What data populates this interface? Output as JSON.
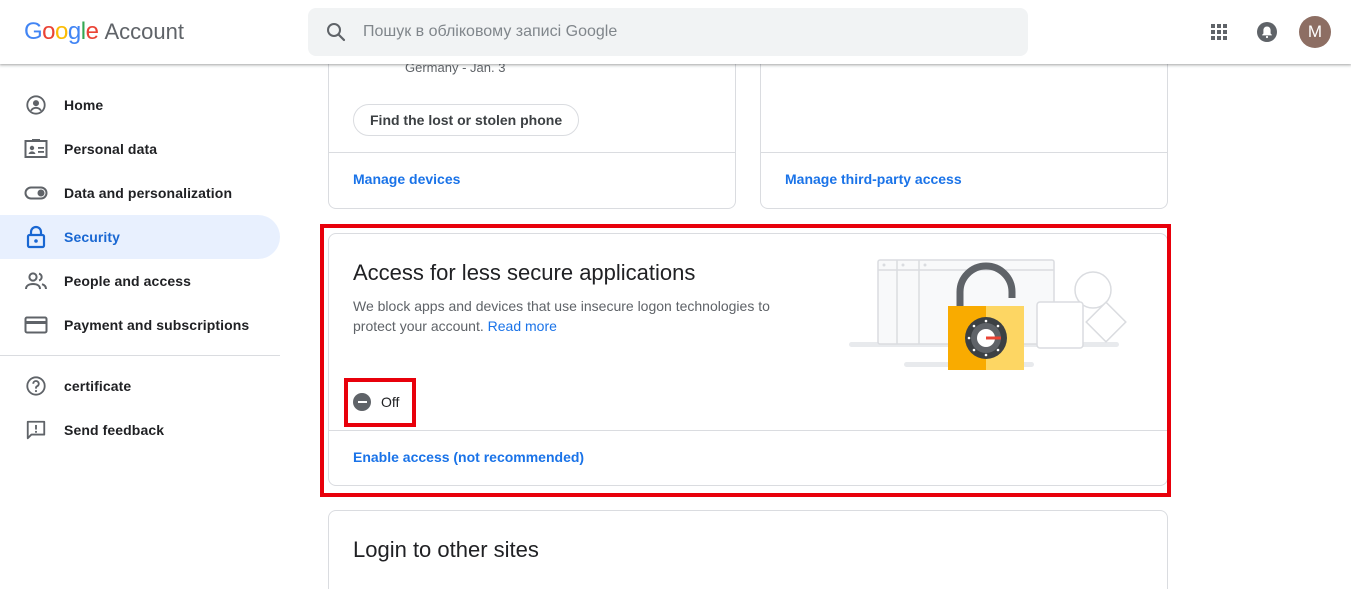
{
  "header": {
    "logo_letters": [
      "G",
      "o",
      "o",
      "g",
      "l",
      "e"
    ],
    "logo_account": "Account",
    "search_placeholder": "Пошук в обліковому записі Google",
    "avatar_initial": "M"
  },
  "sidebar": {
    "items": [
      {
        "label": "Home",
        "icon": "account-circle-icon"
      },
      {
        "label": "Personal data",
        "icon": "id-card-icon"
      },
      {
        "label": "Data and personalization",
        "icon": "toggle-icon"
      },
      {
        "label": "Security",
        "icon": "lock-icon",
        "active": true
      },
      {
        "label": "People and access",
        "icon": "people-icon"
      },
      {
        "label": "Payment and subscriptions",
        "icon": "credit-card-icon"
      }
    ],
    "secondary": [
      {
        "label": "certificate",
        "icon": "help-circle-icon"
      },
      {
        "label": "Send feedback",
        "icon": "feedback-icon"
      }
    ]
  },
  "devices_card": {
    "device_location": "Germany - Jan. 3",
    "find_phone_button": "Find the lost or stolen phone",
    "manage_link": "Manage devices"
  },
  "third_party_card": {
    "manage_link": "Manage third-party access"
  },
  "less_secure_card": {
    "title": "Access for less secure applications",
    "description": "We block apps and devices that use insecure logon technologies to protect your account.",
    "read_more": "Read more",
    "status": "Off",
    "enable_link": "Enable access (not recommended)"
  },
  "login_card": {
    "title": "Login to other sites"
  },
  "colors": {
    "accent_blue": "#1a73e8",
    "active_bg": "#e8f0fe",
    "highlight_red": "#e8000b"
  }
}
